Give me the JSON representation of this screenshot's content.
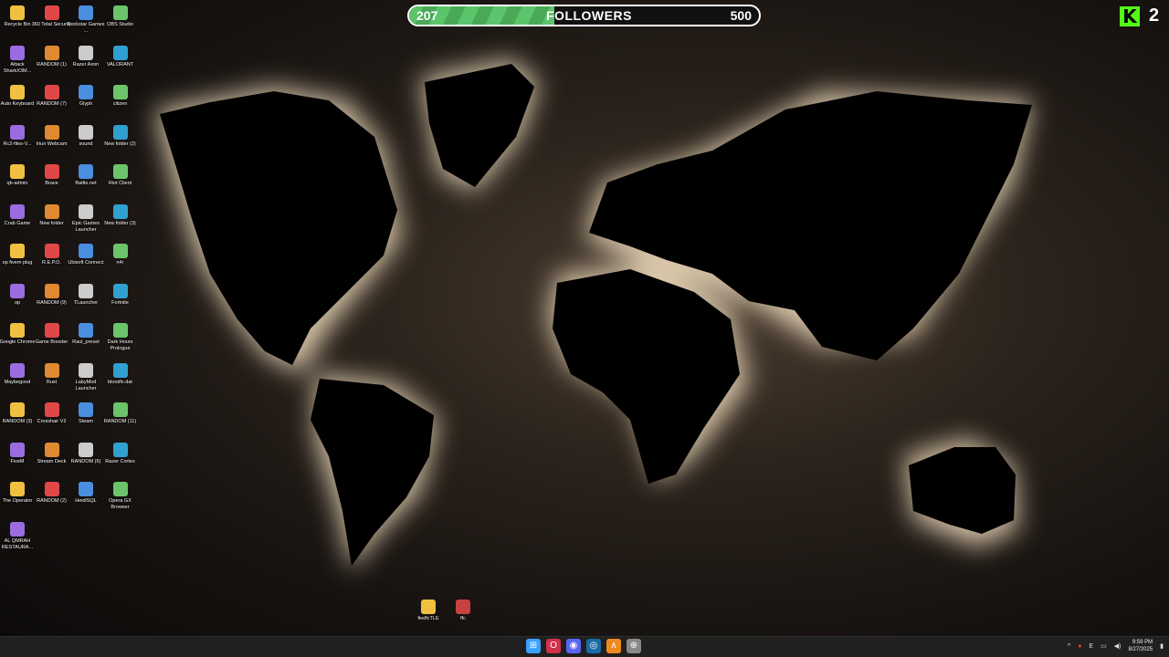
{
  "goal": {
    "current": "207",
    "label": "FOLLOWERS",
    "target": "500",
    "progress": 0.414
  },
  "kick": {
    "logo_letter": "K",
    "count": "2",
    "brand_color": "#53fc18"
  },
  "desktop": {
    "icons": [
      [
        "Recycle Bin",
        "360 Total Security",
        "Rockstar Games ...",
        "OBS Studio"
      ],
      [
        "Attack SharkX3M...",
        "RANDOM (1)",
        "Razer Axon",
        "VALORANT"
      ],
      [
        "Auto Keyboard",
        "RANDOM (7)",
        "Glyph",
        "citizen"
      ],
      [
        "Rc2-files-V...",
        "Iriun Webcam",
        "sound",
        "New folder (2)"
      ],
      [
        "qb-admin",
        "Brave",
        "Battle.net",
        "Riot Client"
      ],
      [
        "Crab Game",
        "New folder",
        "Epic Games Launcher",
        "New folder (3)"
      ],
      [
        "op fivem plug",
        "R.E.P.O.",
        "Ubisoft Connect",
        "n4r"
      ],
      [
        "op",
        "RANDOM (9)",
        "TLauncher",
        "Fortnite"
      ],
      [
        "Google Chrome",
        "Game Booster",
        "Raul_preset",
        "Dark Hours Prologue"
      ],
      [
        "Maybegood",
        "Rust",
        "LabyMod Launcher",
        "bloodfx.dat"
      ],
      [
        "RANDOM (3)",
        "Crosshair V2",
        "Steam",
        "RANDOM (11)"
      ],
      [
        "FiveM",
        "Stream Deck",
        "RANDOM (6)",
        "Razer Cortex"
      ],
      [
        "The Operator",
        "RANDOM (2)",
        "HeidiSQL",
        "Opera GX Browser"
      ],
      [
        "AL QMRAH RESTAURA..."
      ]
    ],
    "bottom_files": [
      "fiedfcTLE",
      "ffc"
    ]
  },
  "taskbar": {
    "apps": [
      "windows-start",
      "opera-gx",
      "discord",
      "steam",
      "fivem",
      "crosshair"
    ],
    "tray_lang": "E",
    "time": "9:59 PM",
    "date": "8/27/2025"
  },
  "colors": {
    "glow": "#f3dfc0",
    "taskbar": "#202020",
    "goal_fill": "#5cc46a"
  }
}
